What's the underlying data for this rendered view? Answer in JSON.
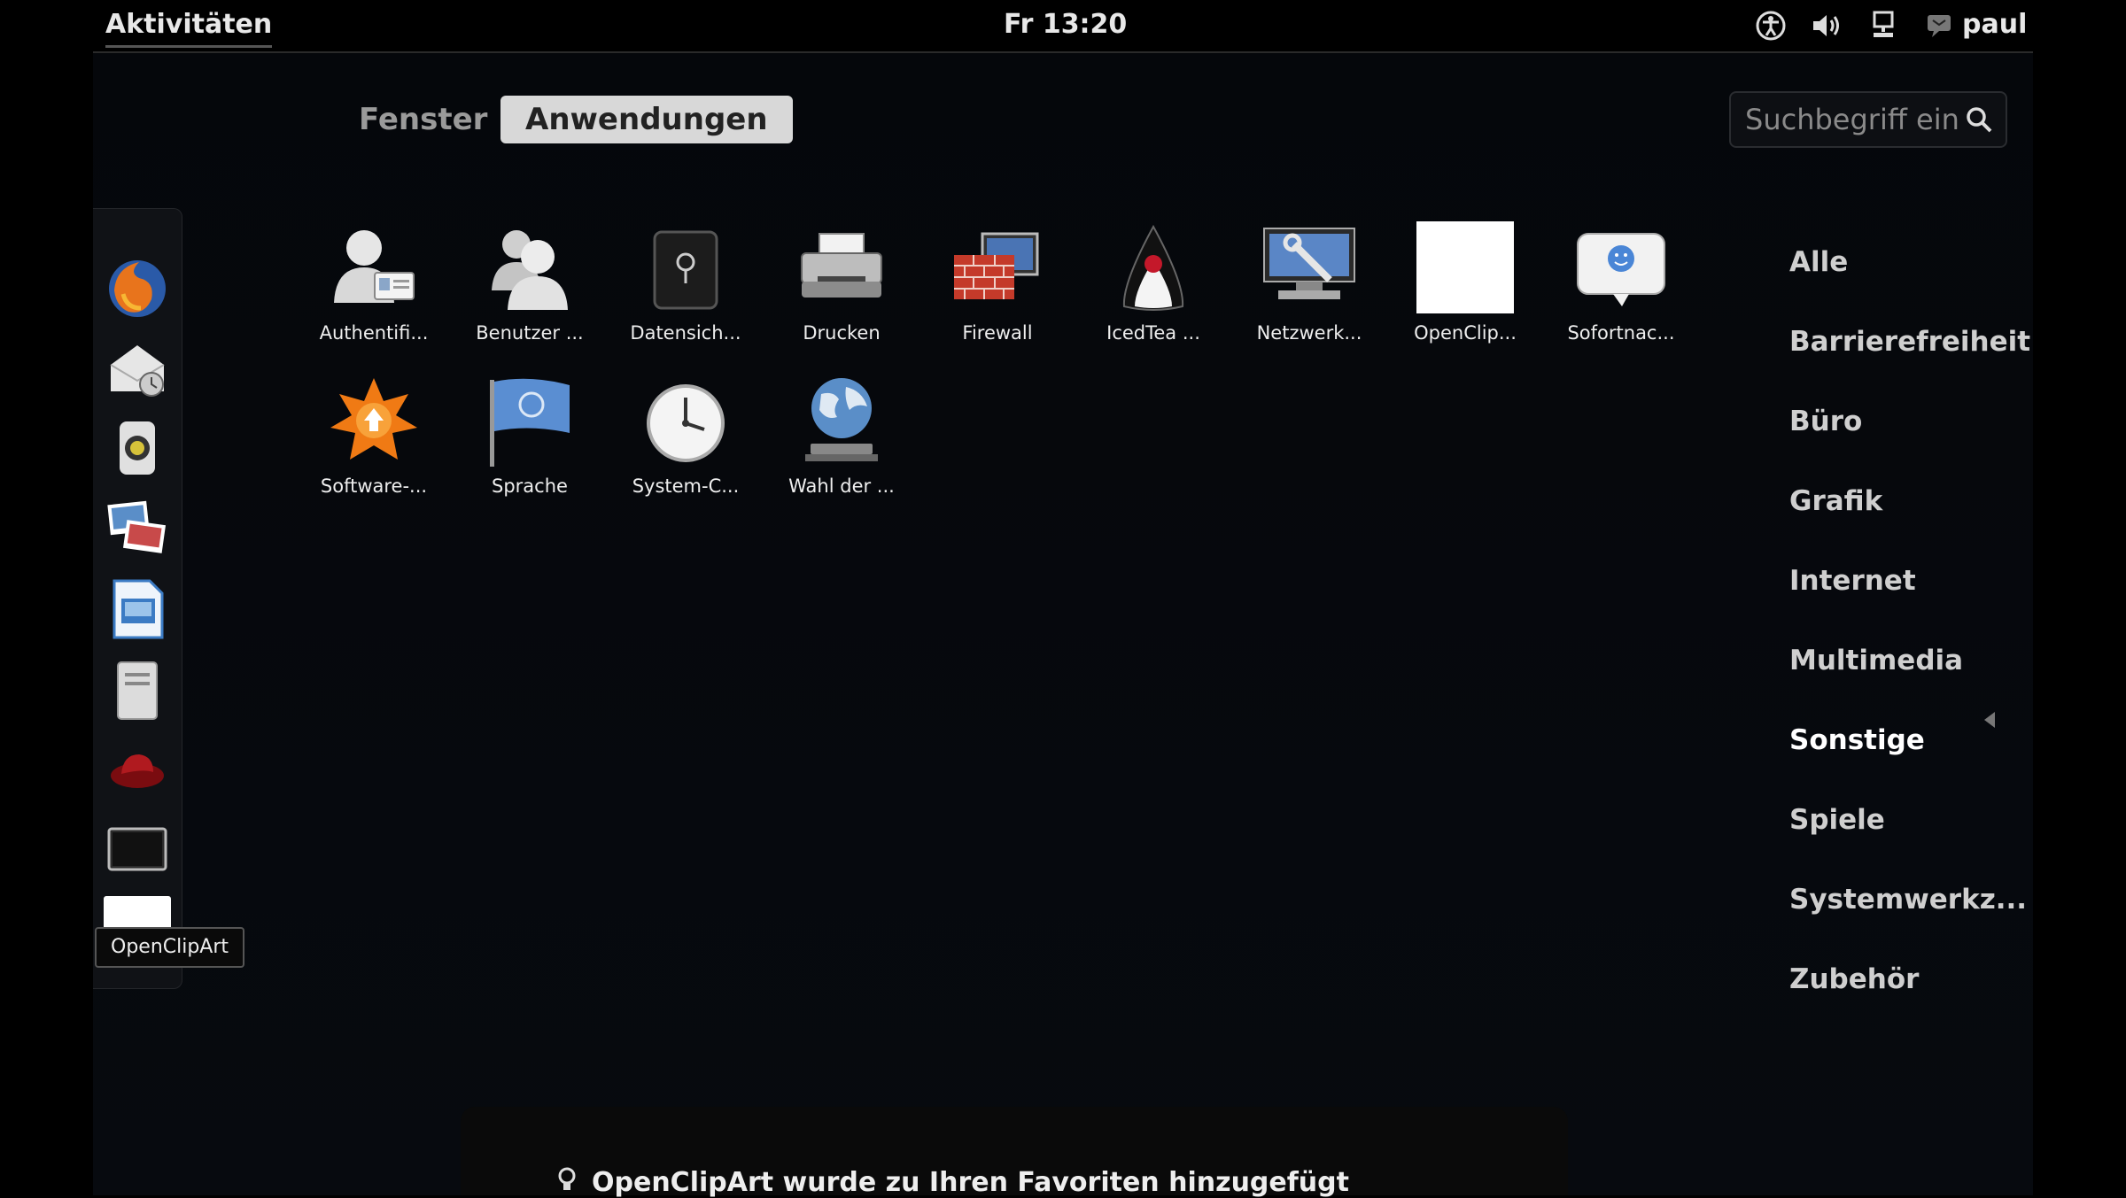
{
  "topbar": {
    "activities_label": "Aktivitäten",
    "clock": "Fr 13:20",
    "user": "paul",
    "tray_icons": [
      "accessibility-icon",
      "volume-icon",
      "network-icon",
      "chat-icon"
    ]
  },
  "view_tabs": [
    {
      "label": "Fenster",
      "active": false
    },
    {
      "label": "Anwendungen",
      "active": true
    }
  ],
  "search": {
    "placeholder": "Suchbegriff eingeben…",
    "visible_text": "Suchbegriff ein"
  },
  "dash": {
    "items": [
      {
        "icon": "firefox-icon"
      },
      {
        "icon": "evolution-mail-icon"
      },
      {
        "icon": "rhythmbox-icon"
      },
      {
        "icon": "shotwell-icon"
      },
      {
        "icon": "libreoffice-writer-icon"
      },
      {
        "icon": "files-icon"
      },
      {
        "icon": "redhat-icon"
      },
      {
        "icon": "terminal-icon"
      },
      {
        "icon": "openclipart-icon"
      }
    ],
    "tooltip": "OpenClipArt"
  },
  "apps": [
    {
      "label": "Authentifi...",
      "icon": "user-card-icon"
    },
    {
      "label": "Benutzer ...",
      "icon": "users-icon"
    },
    {
      "label": "Datensich...",
      "icon": "backup-safe-icon"
    },
    {
      "label": "Drucken",
      "icon": "printer-icon"
    },
    {
      "label": "Firewall",
      "icon": "firewall-icon"
    },
    {
      "label": "IcedTea ...",
      "icon": "java-duke-icon"
    },
    {
      "label": "Netzwerk...",
      "icon": "network-tools-icon"
    },
    {
      "label": "OpenClip...",
      "icon": "openclipart-icon"
    },
    {
      "label": "Sofortnac...",
      "icon": "empathy-chat-icon"
    },
    {
      "label": "Software-...",
      "icon": "software-update-icon"
    },
    {
      "label": "Sprache",
      "icon": "language-flag-icon"
    },
    {
      "label": "System-C...",
      "icon": "clock-icon"
    },
    {
      "label": "Wahl der ...",
      "icon": "globe-icon"
    }
  ],
  "categories": [
    {
      "label": "Alle",
      "selected": false
    },
    {
      "label": "Barrierefreiheit",
      "selected": false
    },
    {
      "label": "Büro",
      "selected": false
    },
    {
      "label": "Grafik",
      "selected": false
    },
    {
      "label": "Internet",
      "selected": false
    },
    {
      "label": "Multimedia",
      "selected": false
    },
    {
      "label": "Sonstige",
      "selected": true
    },
    {
      "label": "Spiele",
      "selected": false
    },
    {
      "label": "Systemwerkz...",
      "selected": false
    },
    {
      "label": "Zubehör",
      "selected": false
    }
  ],
  "notification": {
    "text": "OpenClipArt wurde zu Ihren Favoriten hinzugefügt"
  }
}
